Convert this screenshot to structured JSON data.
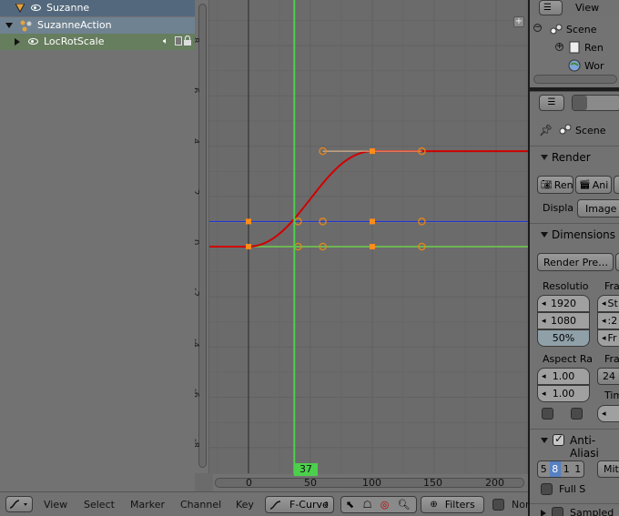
{
  "channels": {
    "object_label": "Suzanne",
    "action_label": "SuzanneAction",
    "group_label": "LocRotScale"
  },
  "graph": {
    "y_ticks": [
      "8",
      "6",
      "4",
      "2",
      "0",
      "-2",
      "-4",
      "-6",
      "-8"
    ],
    "x_ticks": [
      "0",
      "50",
      "100",
      "150",
      "200"
    ],
    "current_frame": "37"
  },
  "chart_data": {
    "type": "line",
    "x_range": [
      -40,
      215
    ],
    "y_range": [
      -9,
      9
    ],
    "current_frame": 37,
    "series": [
      {
        "color": "#d00000",
        "keyframes": [
          [
            0,
            0
          ],
          [
            100,
            3.8
          ]
        ],
        "shape": "bezier"
      },
      {
        "color": "#ff9a70",
        "keyframes": [
          [
            0,
            1
          ],
          [
            100,
            1
          ]
        ],
        "shape": "flat"
      },
      {
        "color": "#1a3ad0",
        "keyframes": [
          [
            0,
            1
          ],
          [
            100,
            1
          ]
        ],
        "shape": "flat"
      },
      {
        "color": "#6fd04a",
        "keyframes": [
          [
            0,
            0
          ],
          [
            100,
            0
          ]
        ],
        "shape": "flat"
      }
    ]
  },
  "footer": {
    "menus": [
      "View",
      "Select",
      "Marker",
      "Channel",
      "Key"
    ],
    "mode": "F-Curve",
    "filters_label": "Filters",
    "only_selected": "Nor"
  },
  "outliner": {
    "view_label": "View",
    "scene": "Scene",
    "render_layers": "Ren",
    "world": "Wor"
  },
  "properties": {
    "context": "Scene",
    "render_panel": "Render",
    "render_button": "Ren",
    "animation_button": "Ani",
    "display_label": "Displa",
    "display_value": "Image",
    "dimensions_panel": "Dimensions",
    "render_presets": "Render Pre…",
    "resolution_label": "Resolutio",
    "frame_label": "Fra",
    "res_x": "1920",
    "res_y": "1080",
    "res_percent": "50%",
    "start_short": "St",
    "end_short": ":2",
    "frame_short": "Fr",
    "aspect_label": "Aspect Ra",
    "frame_rate_label": "Fra",
    "aspect_x": "1.00",
    "aspect_y": "1.00",
    "fps": "24",
    "time_label": "Tim",
    "aa_panel": "Anti-Aliasi",
    "aa_samples": [
      "5",
      "8",
      "1",
      "1"
    ],
    "aa_filter": "Mitc",
    "full_sample": "Full S",
    "sampled_motion": "Sampled"
  },
  "colors": {
    "playhead": "#4cd04c",
    "selected_tab": "#5680c2",
    "red_curve": "#d00000"
  }
}
